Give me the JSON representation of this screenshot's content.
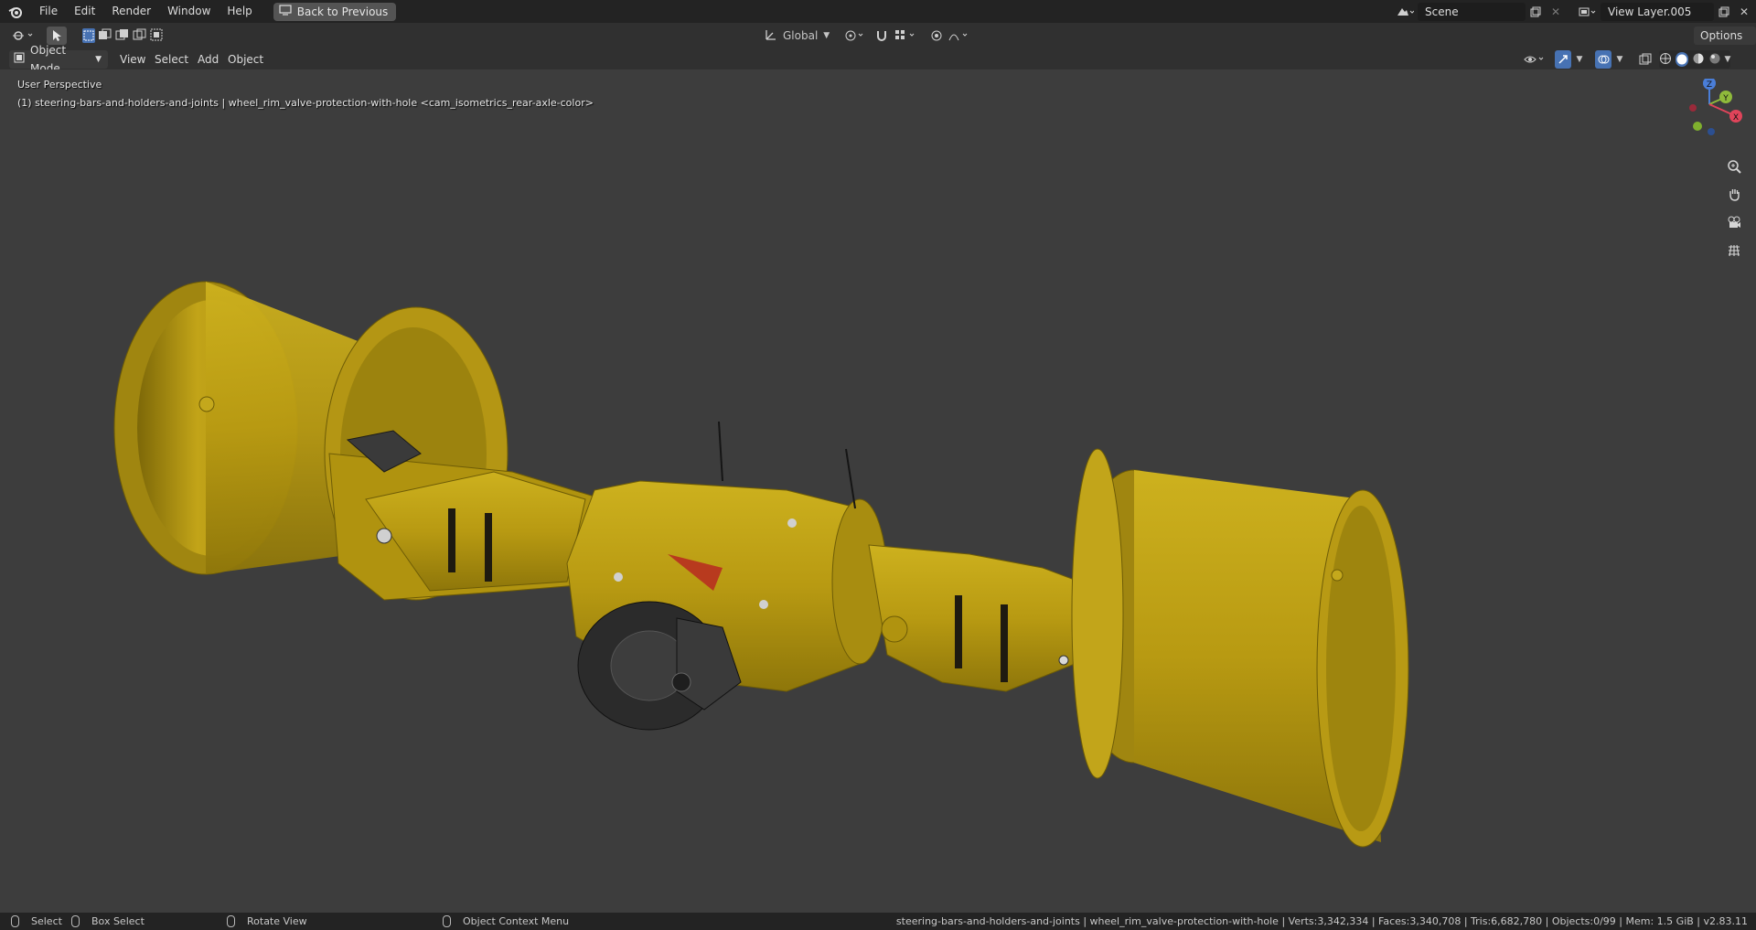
{
  "topbar": {
    "menus": [
      "File",
      "Edit",
      "Render",
      "Window",
      "Help"
    ],
    "back_button": "Back to Previous",
    "scene_name": "Scene",
    "view_layer_name": "View Layer.005"
  },
  "tool_header": {
    "transform_orientation": "Global",
    "options_label": "Options"
  },
  "view_header": {
    "mode": "Object Mode",
    "menus": [
      "View",
      "Select",
      "Add",
      "Object"
    ]
  },
  "viewport": {
    "perspective_label": "User Perspective",
    "object_info": "(1) steering-bars-and-holders-and-joints | wheel_rim_valve-protection-with-hole <cam_isometrics_rear-axle-color>",
    "gizmo_axes": {
      "x": "X",
      "y": "Y",
      "z": "Z"
    },
    "model_color": "#b89a12"
  },
  "statusbar": {
    "select": "Select",
    "box_select": "Box Select",
    "rotate_view": "Rotate View",
    "context_menu": "Object Context Menu",
    "stats": "steering-bars-and-holders-and-joints | wheel_rim_valve-protection-with-hole | Verts:3,342,334 | Faces:3,340,708 | Tris:6,682,780 | Objects:0/99 | Mem: 1.5 GiB | v2.83.11"
  }
}
